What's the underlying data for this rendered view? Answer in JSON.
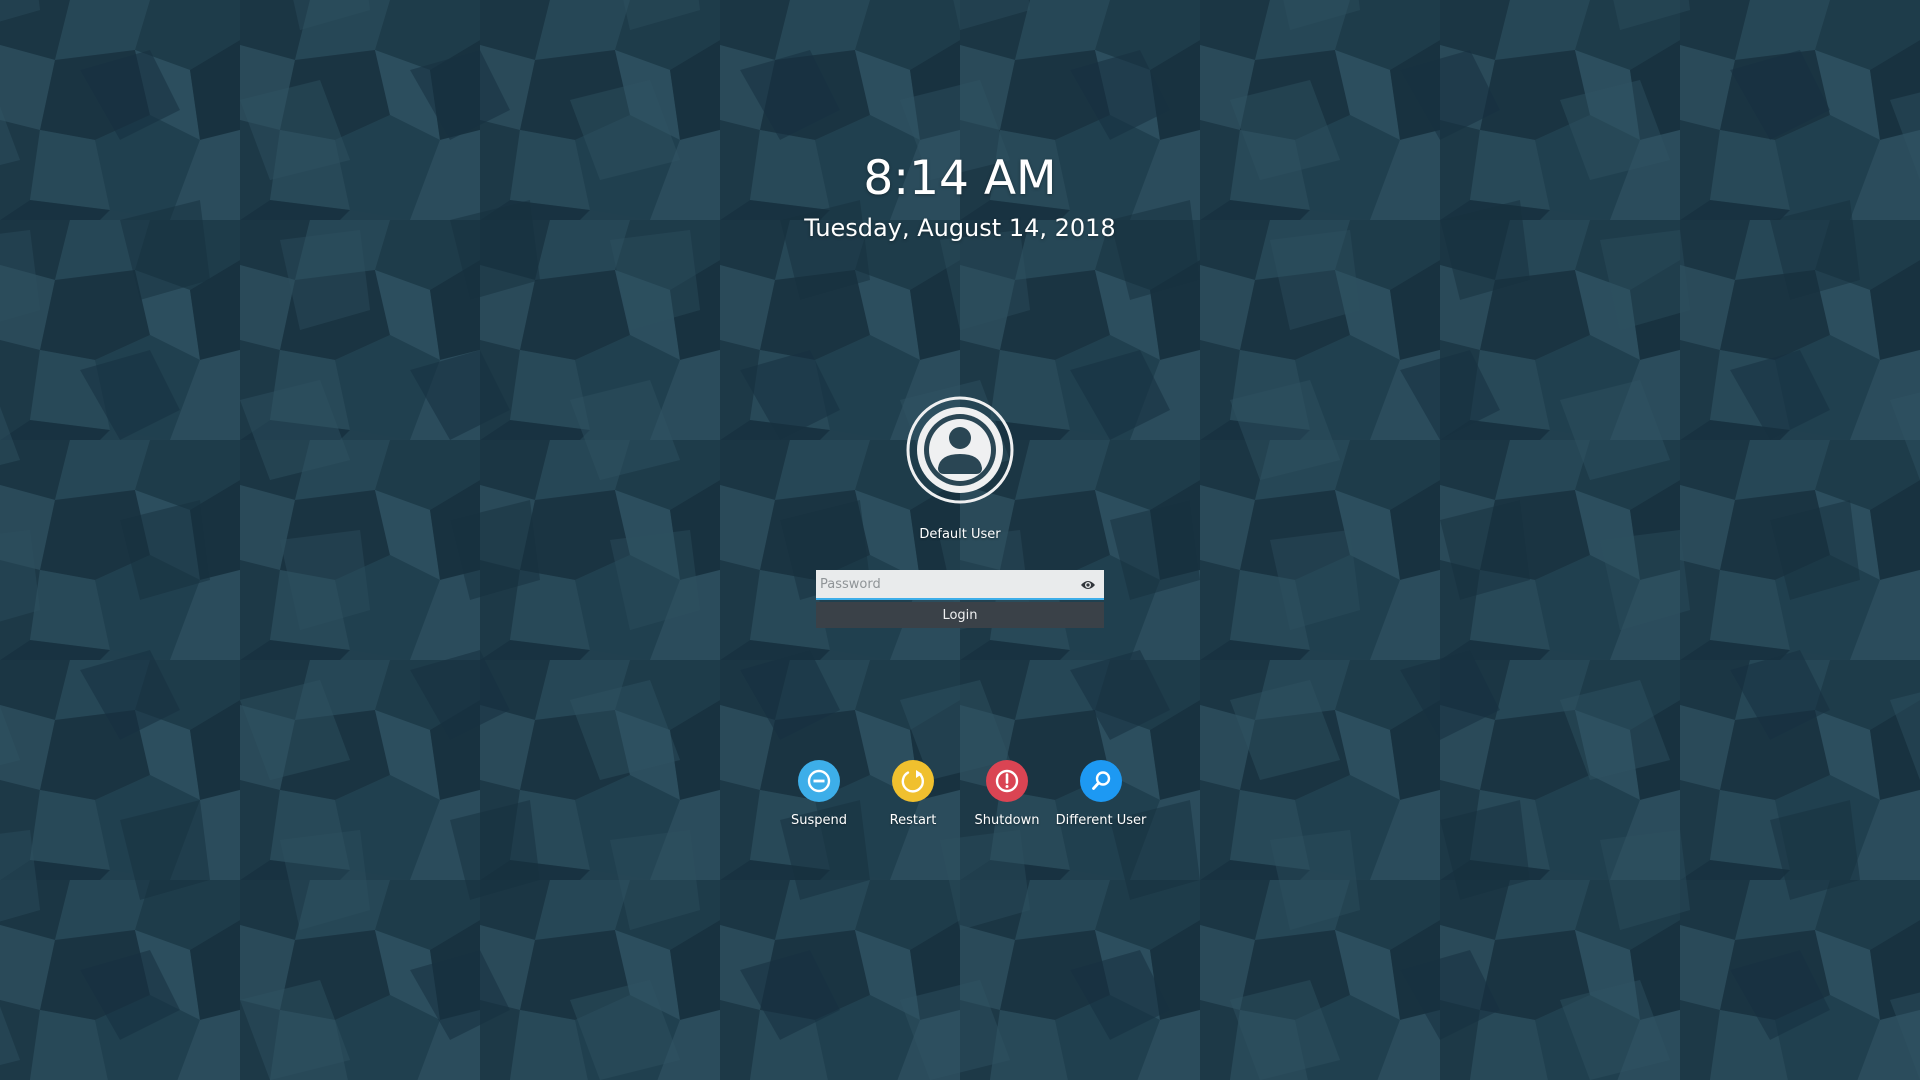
{
  "clock": {
    "time": "8:14 AM",
    "date": "Tuesday, August 14, 2018"
  },
  "user": {
    "name": "Default User",
    "avatar_icon": "user-avatar-icon"
  },
  "login": {
    "password_placeholder": "Password",
    "password_value": "",
    "reveal_icon": "eye-icon",
    "button_label": "Login"
  },
  "actions": [
    {
      "label": "Suspend",
      "icon": "suspend-icon",
      "color": "#3daee9"
    },
    {
      "label": "Restart",
      "icon": "restart-icon",
      "color": "#f0c02e"
    },
    {
      "label": "Shutdown",
      "icon": "power-icon",
      "color": "#da4453"
    },
    {
      "label": "Different User",
      "icon": "switch-user-icon",
      "color": "#1d99f3"
    }
  ],
  "colors": {
    "background": "#1f3d4c",
    "accent": "#3daee9"
  }
}
